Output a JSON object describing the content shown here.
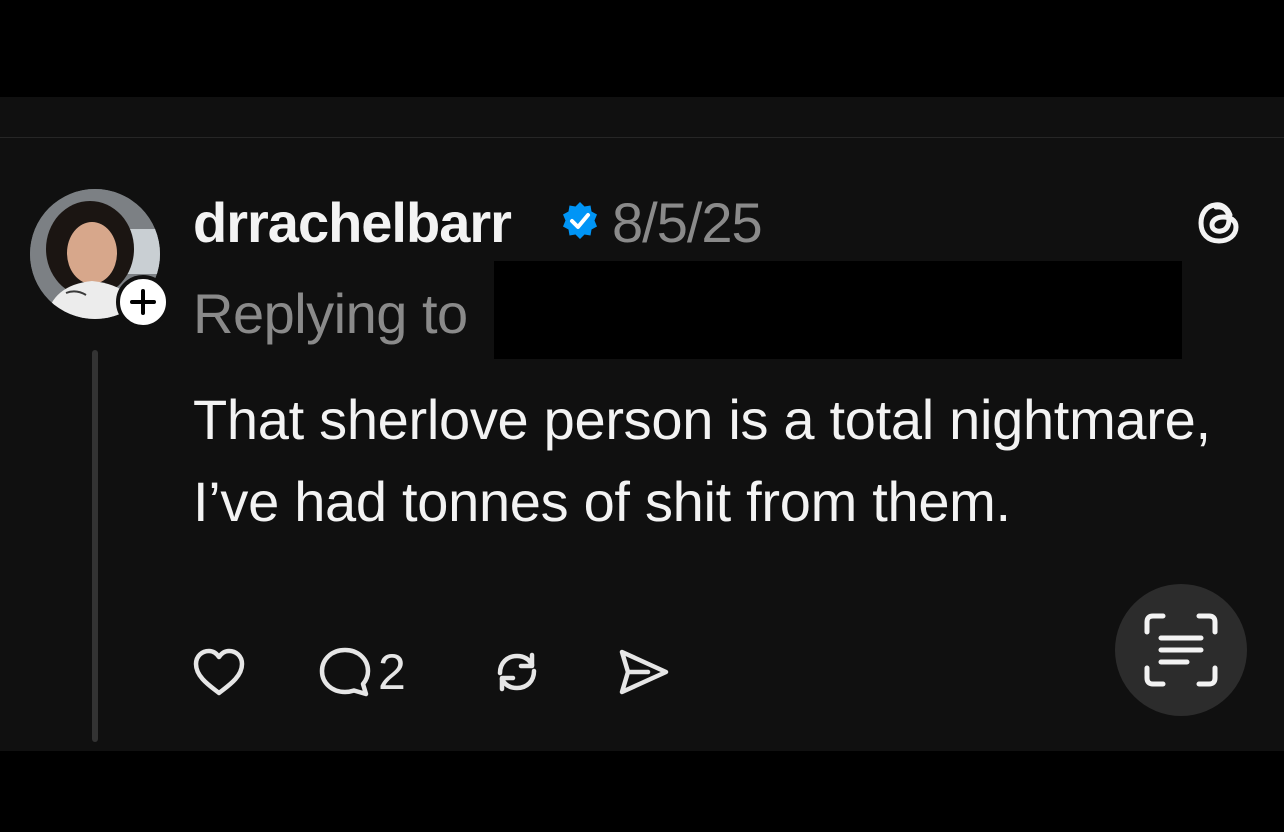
{
  "post": {
    "username": "drrachelbarr",
    "date": "8/5/25",
    "replying_label": "Replying to",
    "body": "That sherlove person is a total nightmare, I’ve had tonnes of shit from them.",
    "reply_count": "2"
  },
  "icons": {
    "verified": "verified-badge-icon",
    "logo": "threads-logo-icon",
    "follow": "plus-icon",
    "like": "heart-icon",
    "reply": "comment-icon",
    "repost": "repost-icon",
    "share": "send-icon",
    "scan": "text-scan-icon"
  },
  "colors": {
    "background": "#101010",
    "verified": "#0095f6",
    "primary_text": "#f3f3f3",
    "secondary_text": "#8a8a8a"
  }
}
